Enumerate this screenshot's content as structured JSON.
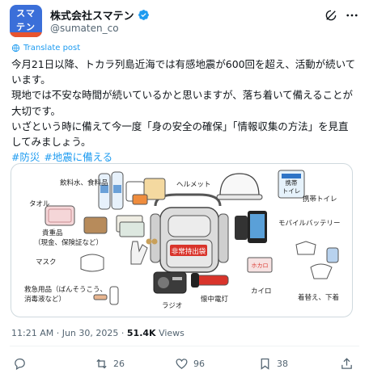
{
  "account": {
    "avatar_text": "スマ テン",
    "display_name": "株式会社スマテン",
    "handle": "@sumaten_co",
    "verified": true
  },
  "translate_label": "Translate post",
  "tweet": {
    "lines": [
      "今月21日以降、トカラ列島近海では有感地震が600回を超え、活動が続いています。",
      "現地では不安な時間が続いているかと思いますが、落ち着いて備えることが大切です。",
      "いざという時に備えて今一度「身の安全の確保」「情報収集の方法」を見直してみましょう。"
    ],
    "hashtags": [
      "#防災",
      "#地震に備える"
    ]
  },
  "illustration": {
    "labels": {
      "drink_food": "飲料水、食料品",
      "towel": "タオル",
      "valuables_1": "貴重品",
      "valuables_2": "（現金、保険証など）",
      "mask": "マスク",
      "firstaid_1": "救急用品（ばんそうこう、",
      "firstaid_2": "消毒液など）",
      "helmet": "ヘルメット",
      "toilet": "携帯トイレ",
      "battery": "モバイルバッテリー",
      "radio": "ラジオ",
      "flashlight": "懐中電灯",
      "warmer": "カイロ",
      "clothes": "着替え、下着",
      "bag_tag": "非常持出袋",
      "toilet_pack_1": "携帯",
      "toilet_pack_2": "トイレ",
      "warmer_pack": "ホカロ"
    }
  },
  "meta": {
    "time": "11:21 AM",
    "date": "Jun 30, 2025",
    "views_count": "51.4K",
    "views_label": "Views"
  },
  "actions": {
    "reply_count": "",
    "repost_count": "26",
    "like_count": "96",
    "bookmark_count": "38"
  },
  "colors": {
    "accent": "#1d9bf0",
    "avatar_bg": "#3b6fd9",
    "avatar_stripe": "#e8542f",
    "bag_tag": "#d9342b"
  }
}
